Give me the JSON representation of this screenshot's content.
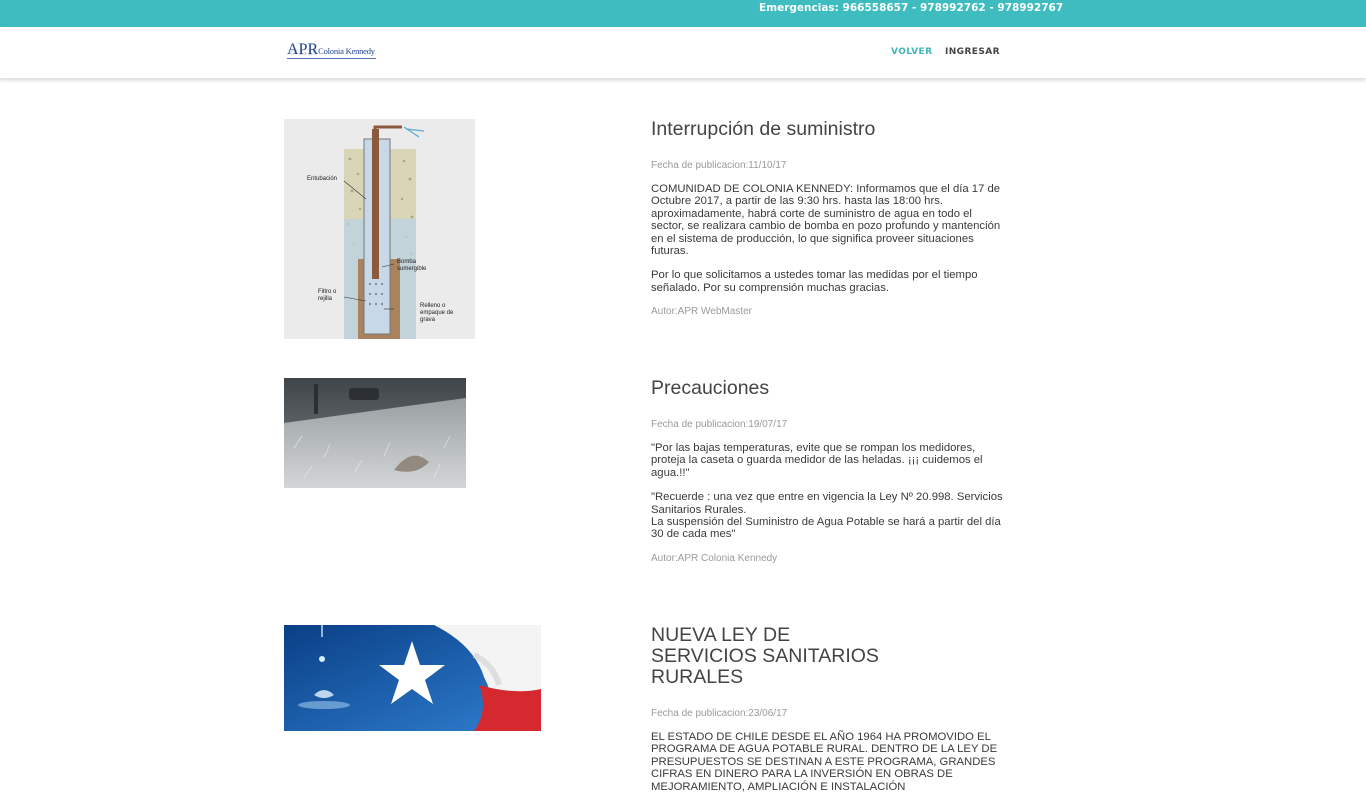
{
  "topbar": {
    "emergencias": "Emergencias: 966558657 - 978992762 - 978992767"
  },
  "header": {
    "logo_main": "APR",
    "logo_sub": "Colonia Kennedy",
    "nav": [
      {
        "label": "VOLVER"
      },
      {
        "label": "INGRESAR"
      }
    ]
  },
  "posts": [
    {
      "title": "Interrupción de suministro",
      "date": "Fecha de publicacion:11/10/17",
      "paragraphs": [
        "COMUNIDAD DE COLONIA KENNEDY: Informamos que el día 17 de Octubre 2017, a partir de las 9:30 hrs. hasta las 18:00 hrs. aproximadamente, habrá corte de suministro de agua en todo el sector, se realizara cambio de bomba en pozo profundo y mantención en el sistema de producción, lo que significa proveer situaciones futuras.",
        "Por lo que solicitamos a ustedes tomar las medidas por el tiempo señalado. Por su comprensión muchas gracias."
      ],
      "author": "Autor:APR WebMaster",
      "image_labels": {
        "l1": "Entubación",
        "l2": "Bomba sumergible",
        "l3": "Filtro o rejilla",
        "l4": "Relleno o empaque de grava"
      }
    },
    {
      "title": "Precauciones",
      "date": "Fecha de publicacion:19/07/17",
      "paragraphs": [
        "\"Por las bajas temperaturas, evite que se rompan los medidores, proteja la caseta o guarda medidor de las heladas. ¡¡¡ cuidemos el agua.!!\"",
        "\"Recuerde : una vez que entre en vigencia la Ley Nº 20.998. Servicios Sanitarios Rurales.\nLa suspensión del Suministro de Agua Potable se hará a partir del día 30 de cada mes\""
      ],
      "author": "Autor:APR Colonia Kennedy"
    },
    {
      "title": "NUEVA LEY DE SERVICIOS SANITARIOS RURALES",
      "date": "Fecha de publicacion:23/06/17",
      "paragraphs": [
        "EL ESTADO DE CHILE DESDE EL AÑO 1964 HA PROMOVIDO EL PROGRAMA DE AGUA POTABLE RURAL. DENTRO DE LA LEY DE PRESUPUESTOS SE DESTINAN A ESTE PROGRAMA, GRANDES CIFRAS EN DINERO PARA LA INVERSIÓN EN OBRAS DE MEJORAMIENTO, AMPLIACIÓN E INSTALACIÓN"
      ]
    }
  ],
  "colors": {
    "topbar": "#3fbcbf",
    "accent": "#3fb6b9"
  }
}
